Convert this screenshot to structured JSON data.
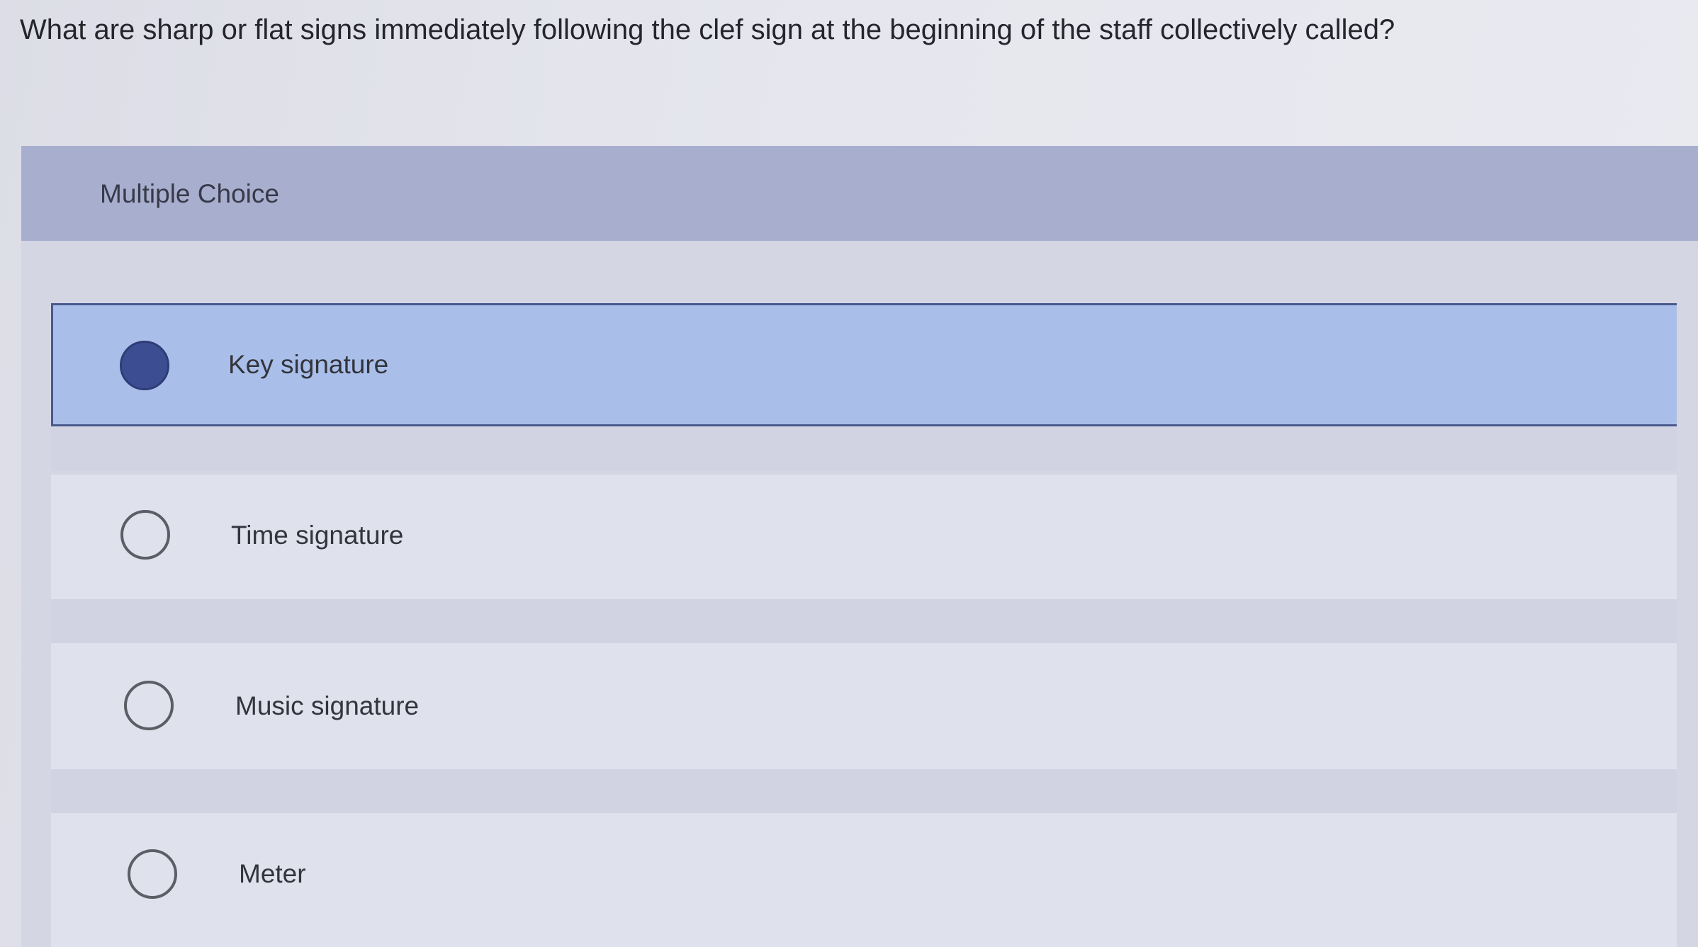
{
  "question": {
    "text": "What are sharp or flat signs immediately following the clef sign at the beginning of the staff collectively called?"
  },
  "multiple_choice": {
    "header_label": "Multiple Choice",
    "options": [
      {
        "label": "Key signature",
        "selected": true
      },
      {
        "label": "Time signature",
        "selected": false
      },
      {
        "label": "Music signature",
        "selected": false
      },
      {
        "label": "Meter",
        "selected": false
      }
    ]
  },
  "colors": {
    "selected_option_bg": "#a9bfe9",
    "selected_radio": "#3d4d92",
    "header_bg": "#a8afce"
  }
}
